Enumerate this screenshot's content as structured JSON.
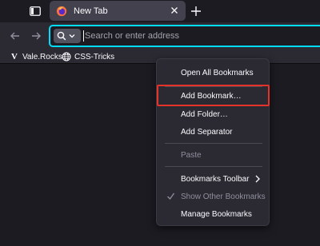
{
  "tab": {
    "title": "New Tab"
  },
  "urlbar": {
    "placeholder": "Search or enter address"
  },
  "bookmarks": [
    {
      "label": "Vale.Rocks",
      "icon": "vale-v-logo"
    },
    {
      "label": "CSS-Tricks",
      "icon": "globe-icon"
    }
  ],
  "context_menu": {
    "open_all": "Open All Bookmarks",
    "add_bookmark": "Add Bookmark…",
    "add_folder": "Add Folder…",
    "add_separator": "Add Separator",
    "paste": "Paste",
    "bookmarks_toolbar": "Bookmarks Toolbar",
    "show_other": "Show Other Bookmarks",
    "manage": "Manage Bookmarks"
  },
  "colors": {
    "highlight": "#e5332a",
    "urlbar_focus": "#00ddff",
    "background": "#1c1b22",
    "toolbar": "#2b2a33"
  }
}
